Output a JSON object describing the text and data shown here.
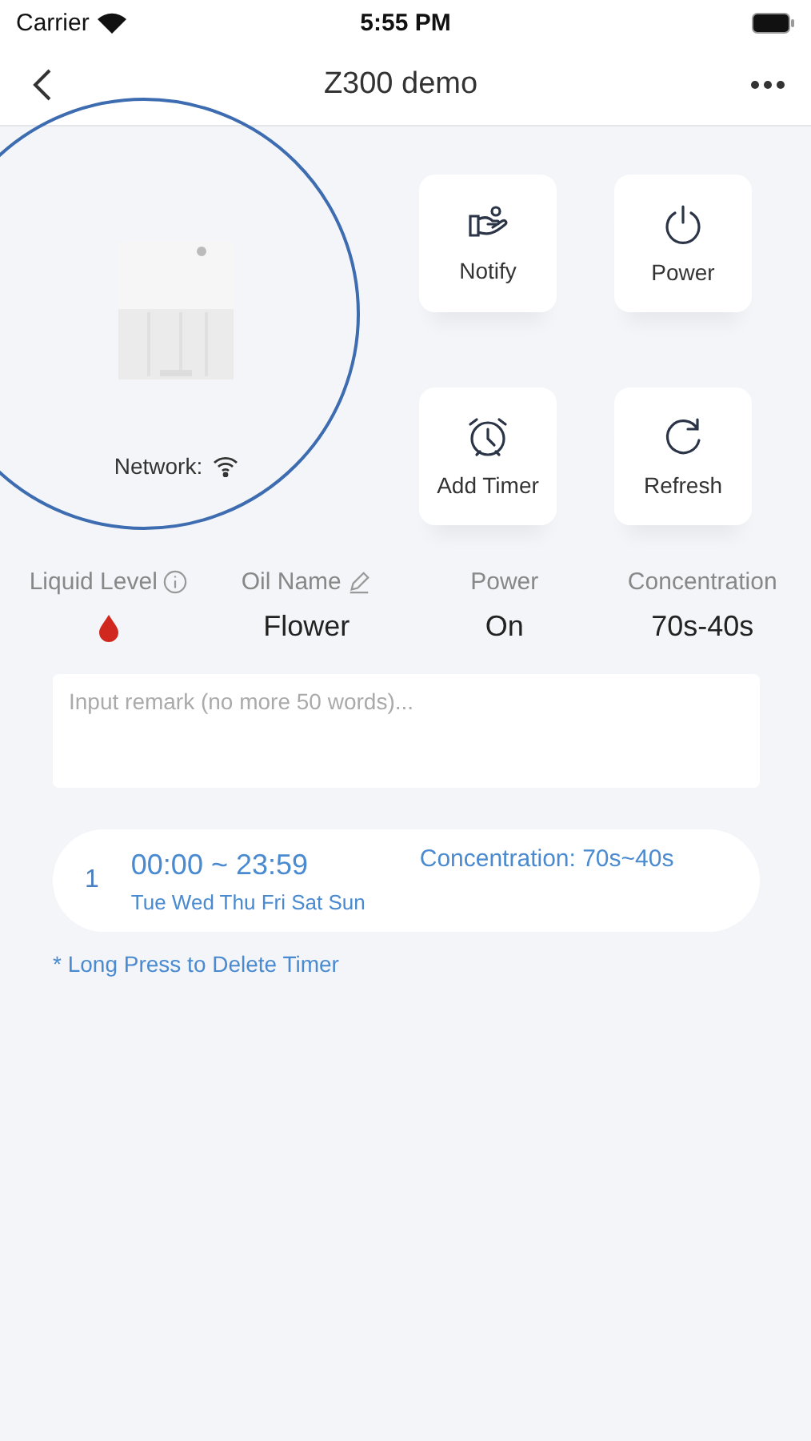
{
  "status_bar": {
    "carrier": "Carrier",
    "time": "5:55 PM"
  },
  "nav": {
    "title": "Z300 demo"
  },
  "device": {
    "network_label": "Network:"
  },
  "actions": [
    {
      "kind": "notify",
      "label": "Notify"
    },
    {
      "kind": "power",
      "label": "Power"
    },
    {
      "kind": "timer",
      "label": "Add Timer"
    },
    {
      "kind": "refresh",
      "label": "Refresh"
    }
  ],
  "stats": [
    {
      "kind": "drop",
      "label": "Liquid Level",
      "label_icon": {
        "kind": "info"
      },
      "color": "#d0281e"
    },
    {
      "kind": "text",
      "label": "Oil Name",
      "label_icon": {
        "kind": "edit"
      },
      "value": "Flower"
    },
    {
      "kind": "text",
      "label": "Power",
      "value": "On"
    },
    {
      "kind": "text",
      "label": "Concentration",
      "value": "70s-40s"
    }
  ],
  "remark": {
    "placeholder": "Input remark (no more 50 words)..."
  },
  "timers": [
    {
      "index": "1",
      "time": "00:00 ~ 23:59",
      "days": "Tue Wed Thu Fri Sat Sun",
      "concentration": "Concentration: 70s~40s"
    }
  ],
  "note": "* Long Press to Delete Timer"
}
